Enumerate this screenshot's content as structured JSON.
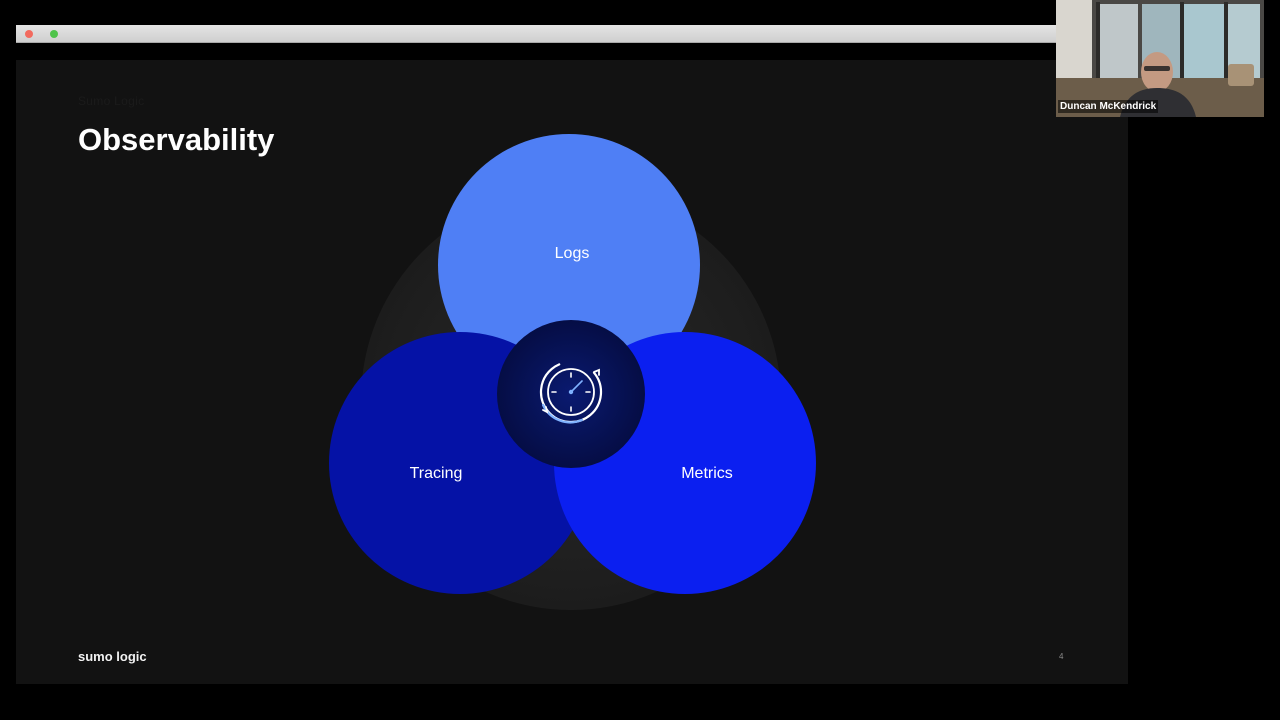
{
  "slide": {
    "kicker": "Sumo Logic",
    "title": "Observability",
    "footer_brand": "sumo logic",
    "page_number": "4"
  },
  "diagram": {
    "labels": {
      "logs": "Logs",
      "tracing": "Tracing",
      "metrics": "Metrics"
    },
    "center_icon": "gauge-cycle-icon"
  },
  "colors": {
    "slide_background": "#121212",
    "logs_circle": "#4f7ff5",
    "tracing_circle": "#0512a6",
    "metrics_circle": "#0b1ff0",
    "center_circle": "#061052",
    "center_icon_accent": "#7fb2ff"
  },
  "participant": {
    "name": "Duncan McKendrick"
  }
}
